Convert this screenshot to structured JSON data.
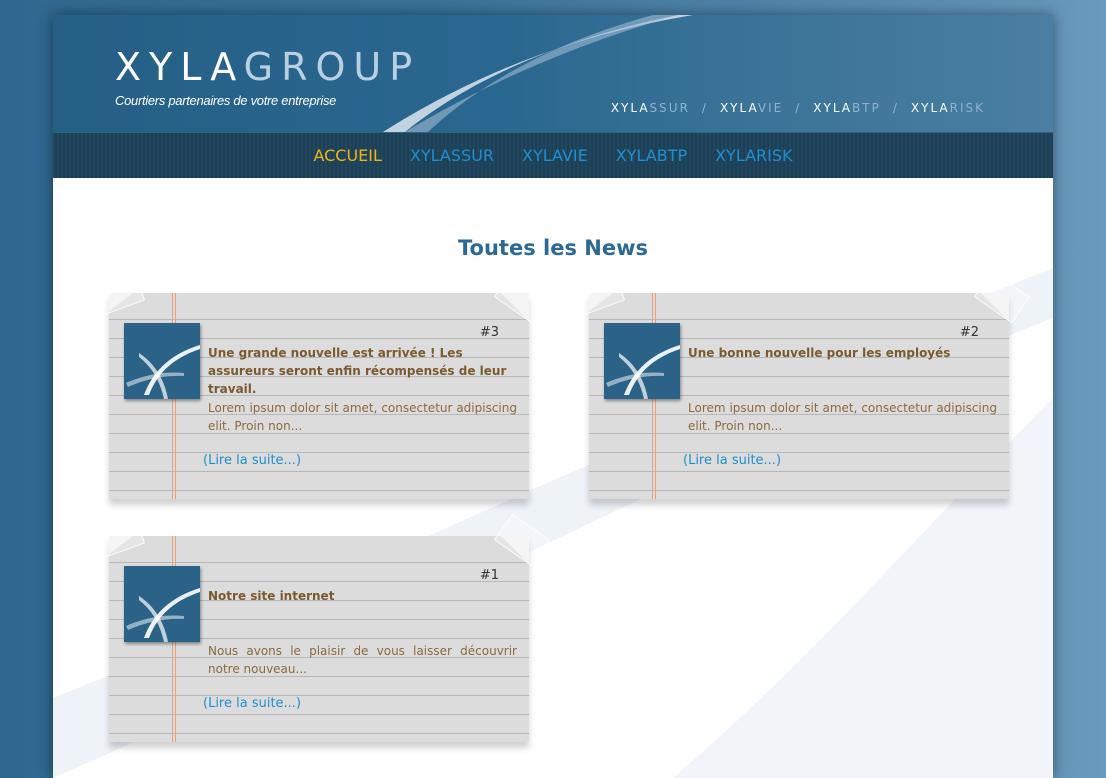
{
  "header": {
    "logo_main": "XYLA",
    "logo_thin": "GROUP",
    "tagline": "Courtiers partenaires de votre entreprise",
    "brand_links": [
      {
        "prefix": "XYLA",
        "suffix": "SSUR"
      },
      {
        "prefix": "XYLA",
        "suffix": "VIE"
      },
      {
        "prefix": "XYLA",
        "suffix": "BTP"
      },
      {
        "prefix": "XYLA",
        "suffix": "RISK"
      }
    ],
    "brand_sep": "/"
  },
  "nav": {
    "items": [
      {
        "label": "ACCUEIL",
        "active": true
      },
      {
        "label": "XYLASSUR",
        "active": false
      },
      {
        "label": "XYLAVIE",
        "active": false
      },
      {
        "label": "XYLABTP",
        "active": false
      },
      {
        "label": "XYLARISK",
        "active": false
      }
    ]
  },
  "main": {
    "title": "Toutes les News",
    "news": [
      {
        "number": "#3",
        "headline": "Une grande nouvelle est arrivée ! Les assureurs seront enfin récompensés de leur travail.",
        "excerpt": "Lorem ipsum dolor sit amet, consectetur adipiscing elit. Proin non...",
        "more": "(Lire la suite...)"
      },
      {
        "number": "#2",
        "headline": "Une bonne nouvelle pour les employés",
        "excerpt": "Lorem ipsum dolor sit amet, consectetur adipiscing elit. Proin non...",
        "more": "(Lire la suite...)"
      },
      {
        "number": "#1",
        "headline": "Notre site internet",
        "excerpt": "Nous avons le plaisir de vous laisser découvrir notre nouveau...",
        "more": "(Lire la suite...)"
      }
    ]
  },
  "colors": {
    "brand_blue": "#2a6790",
    "nav_link": "#1f8fd0",
    "nav_active": "#f0b418",
    "headline": "#7b5a2f",
    "excerpt": "#8b6a3d",
    "paper": "#dcdcdc"
  }
}
